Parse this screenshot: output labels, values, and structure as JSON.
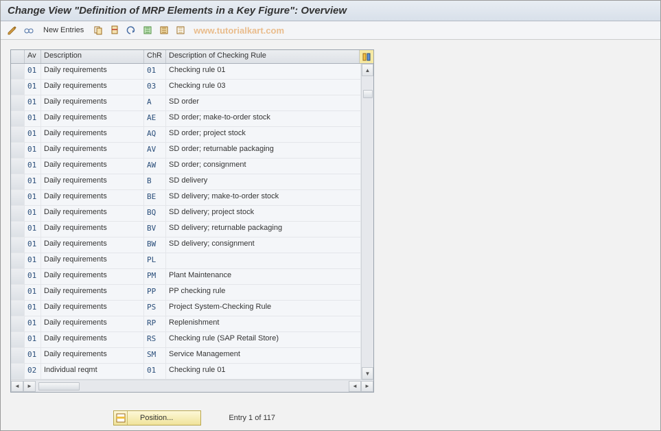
{
  "title": "Change View \"Definition of MRP Elements in a Key Figure\": Overview",
  "toolbar": {
    "new_entries": "New Entries"
  },
  "watermark": "www.tutorialkart.com",
  "headers": {
    "av": "Av",
    "desc": "Description",
    "chr": "ChR",
    "rule": "Description of Checking Rule"
  },
  "rows": [
    {
      "av": "01",
      "desc": "Daily requirements",
      "chr": "01",
      "rule": "Checking rule 01"
    },
    {
      "av": "01",
      "desc": "Daily requirements",
      "chr": "03",
      "rule": "Checking rule 03"
    },
    {
      "av": "01",
      "desc": "Daily requirements",
      "chr": "A",
      "rule": "SD order"
    },
    {
      "av": "01",
      "desc": "Daily requirements",
      "chr": "AE",
      "rule": "SD order; make-to-order stock"
    },
    {
      "av": "01",
      "desc": "Daily requirements",
      "chr": "AQ",
      "rule": "SD order; project stock"
    },
    {
      "av": "01",
      "desc": "Daily requirements",
      "chr": "AV",
      "rule": "SD order; returnable packaging"
    },
    {
      "av": "01",
      "desc": "Daily requirements",
      "chr": "AW",
      "rule": "SD order; consignment"
    },
    {
      "av": "01",
      "desc": "Daily requirements",
      "chr": "B",
      "rule": "SD delivery"
    },
    {
      "av": "01",
      "desc": "Daily requirements",
      "chr": "BE",
      "rule": "SD delivery; make-to-order stock"
    },
    {
      "av": "01",
      "desc": "Daily requirements",
      "chr": "BQ",
      "rule": "SD delivery; project stock"
    },
    {
      "av": "01",
      "desc": "Daily requirements",
      "chr": "BV",
      "rule": "SD delivery; returnable packaging"
    },
    {
      "av": "01",
      "desc": "Daily requirements",
      "chr": "BW",
      "rule": "SD delivery; consignment"
    },
    {
      "av": "01",
      "desc": "Daily requirements",
      "chr": "PL",
      "rule": ""
    },
    {
      "av": "01",
      "desc": "Daily requirements",
      "chr": "PM",
      "rule": "Plant Maintenance"
    },
    {
      "av": "01",
      "desc": "Daily requirements",
      "chr": "PP",
      "rule": "PP checking rule"
    },
    {
      "av": "01",
      "desc": "Daily requirements",
      "chr": "PS",
      "rule": "Project System-Checking Rule"
    },
    {
      "av": "01",
      "desc": "Daily requirements",
      "chr": "RP",
      "rule": "Replenishment"
    },
    {
      "av": "01",
      "desc": "Daily requirements",
      "chr": "RS",
      "rule": "Checking rule (SAP Retail Store)"
    },
    {
      "av": "01",
      "desc": "Daily requirements",
      "chr": "SM",
      "rule": "Service Management"
    },
    {
      "av": "02",
      "desc": "Individual reqmt",
      "chr": "01",
      "rule": "Checking rule 01"
    }
  ],
  "footer": {
    "position_label": "Position...",
    "entry_text": "Entry 1 of 117"
  }
}
